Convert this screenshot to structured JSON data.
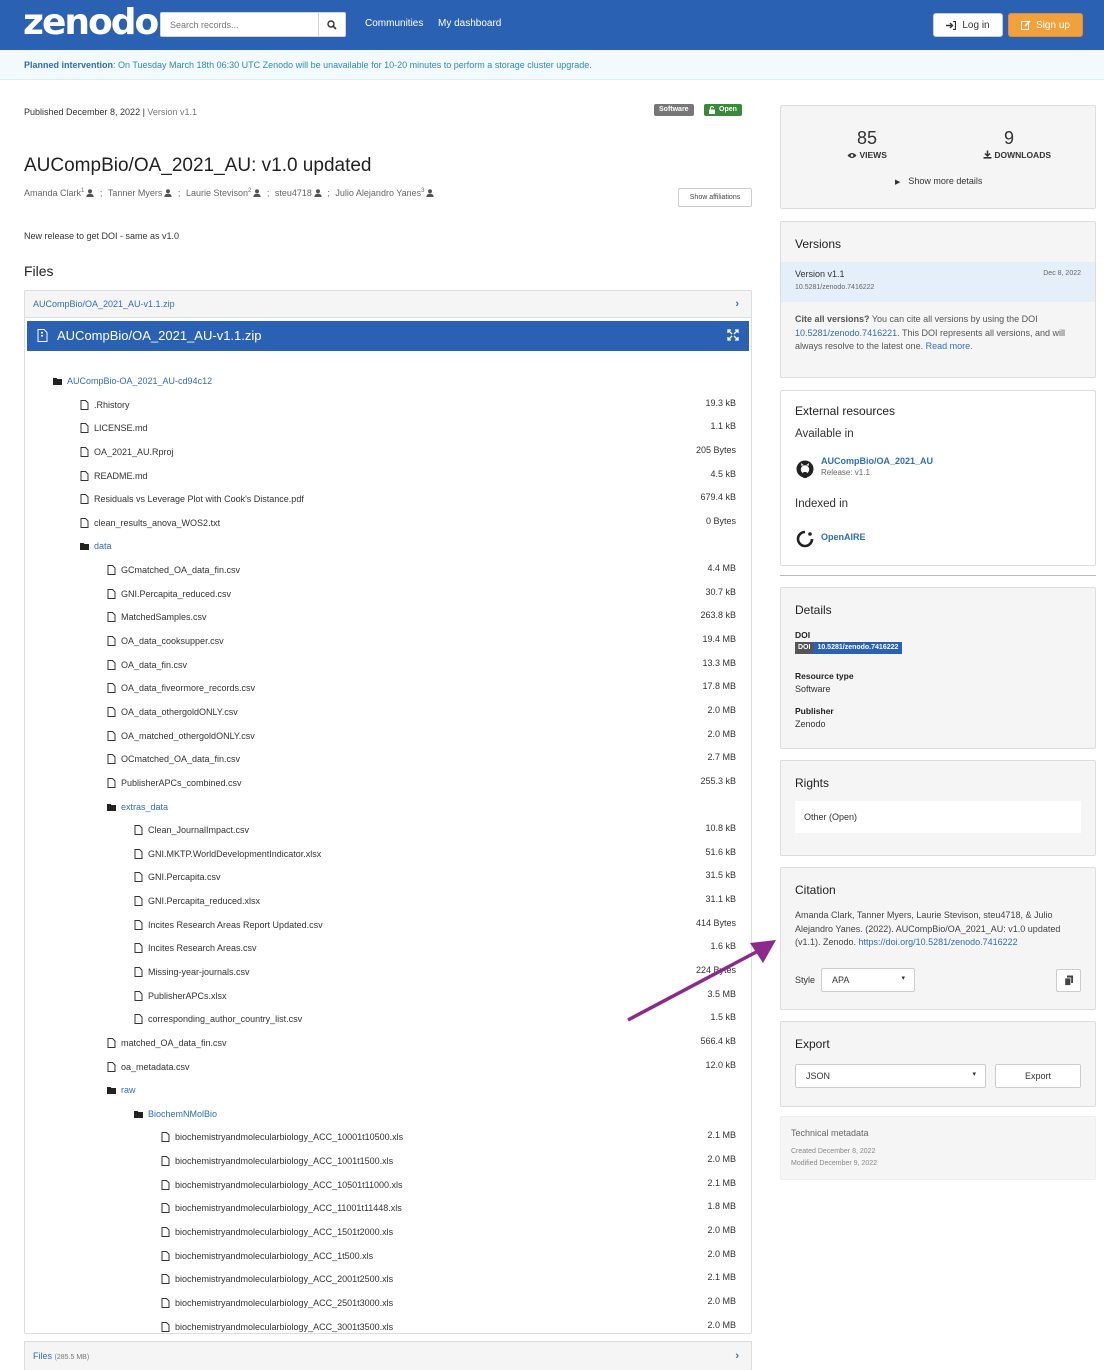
{
  "header": {
    "logo": "zenodo",
    "search_placeholder": "Search records...",
    "nav": [
      "Communities",
      "My dashboard"
    ],
    "login_label": "Log in",
    "signup_label": "Sign up"
  },
  "banner": {
    "title": "Planned intervention",
    "message": ": On Tuesday March 18th 06:30 UTC Zenodo will be unavailable for 10-20 minutes to perform a storage cluster upgrade."
  },
  "record": {
    "published": "Published December 8, 2022",
    "version": "Version v1.1",
    "badges": [
      {
        "label": "Software",
        "color": "#777777"
      },
      {
        "label": "Open",
        "color": "#3a8a3a"
      }
    ],
    "title": "AUCompBio/OA_2021_AU: v1.0 updated",
    "authors": [
      {
        "name": "Amanda Clark",
        "sup": "1"
      },
      {
        "name": "Tanner Myers",
        "sup": ""
      },
      {
        "name": "Laurie Stevison",
        "sup": "2"
      },
      {
        "name": "steu4718",
        "sup": ""
      },
      {
        "name": "Julio Alejandro Yanes",
        "sup": "3"
      }
    ],
    "show_affiliations": "Show affiliations",
    "description": "New release to get DOI - same as v1.0"
  },
  "files": {
    "heading": "Files",
    "archive_link": "AUCompBio/OA_2021_AU-v1.1.zip",
    "preview_title": "AUCompBio/OA_2021_AU-v1.1.zip",
    "footer_label": "Files",
    "footer_size": "(285.5 MB)",
    "tree": [
      {
        "name": "AUCompBio-OA_2021_AU-cd94c12",
        "size": "",
        "level": 0,
        "folder": true
      },
      {
        "name": ".Rhistory",
        "size": "19.3 kB",
        "level": 1,
        "folder": false
      },
      {
        "name": "LICENSE.md",
        "size": "1.1 kB",
        "level": 1,
        "folder": false
      },
      {
        "name": "OA_2021_AU.Rproj",
        "size": "205 Bytes",
        "level": 1,
        "folder": false
      },
      {
        "name": "README.md",
        "size": "4.5 kB",
        "level": 1,
        "folder": false
      },
      {
        "name": "Residuals vs Leverage Plot with Cook's Distance.pdf",
        "size": "679.4 kB",
        "level": 1,
        "folder": false
      },
      {
        "name": "clean_results_anova_WOS2.txt",
        "size": "0 Bytes",
        "level": 1,
        "folder": false
      },
      {
        "name": "data",
        "size": "",
        "level": 1,
        "folder": true
      },
      {
        "name": "GCmatched_OA_data_fin.csv",
        "size": "4.4 MB",
        "level": 2,
        "folder": false
      },
      {
        "name": "GNI.Percapita_reduced.csv",
        "size": "30.7 kB",
        "level": 2,
        "folder": false
      },
      {
        "name": "MatchedSamples.csv",
        "size": "263.8 kB",
        "level": 2,
        "folder": false
      },
      {
        "name": "OA_data_cooksupper.csv",
        "size": "19.4 MB",
        "level": 2,
        "folder": false
      },
      {
        "name": "OA_data_fin.csv",
        "size": "13.3 MB",
        "level": 2,
        "folder": false
      },
      {
        "name": "OA_data_fiveormore_records.csv",
        "size": "17.8 MB",
        "level": 2,
        "folder": false
      },
      {
        "name": "OA_data_othergoldONLY.csv",
        "size": "2.0 MB",
        "level": 2,
        "folder": false
      },
      {
        "name": "OA_matched_othergoldONLY.csv",
        "size": "2.0 MB",
        "level": 2,
        "folder": false
      },
      {
        "name": "OCmatched_OA_data_fin.csv",
        "size": "2.7 MB",
        "level": 2,
        "folder": false
      },
      {
        "name": "PublisherAPCs_combined.csv",
        "size": "255.3 kB",
        "level": 2,
        "folder": false
      },
      {
        "name": "extras_data",
        "size": "",
        "level": 2,
        "folder": true
      },
      {
        "name": "Clean_JournalImpact.csv",
        "size": "10.8 kB",
        "level": 3,
        "folder": false
      },
      {
        "name": "GNI.MKTP.WorldDevelopmentIndicator.xlsx",
        "size": "51.6 kB",
        "level": 3,
        "folder": false
      },
      {
        "name": "GNI.Percapita.csv",
        "size": "31.5 kB",
        "level": 3,
        "folder": false
      },
      {
        "name": "GNI.Percapita_reduced.xlsx",
        "size": "31.1 kB",
        "level": 3,
        "folder": false
      },
      {
        "name": "Incites Research Areas Report Updated.csv",
        "size": "414 Bytes",
        "level": 3,
        "folder": false
      },
      {
        "name": "Incites Research Areas.csv",
        "size": "1.6 kB",
        "level": 3,
        "folder": false
      },
      {
        "name": "Missing-year-journals.csv",
        "size": "224 Bytes",
        "level": 3,
        "folder": false
      },
      {
        "name": "PublisherAPCs.xlsx",
        "size": "3.5 MB",
        "level": 3,
        "folder": false
      },
      {
        "name": "corresponding_author_country_list.csv",
        "size": "1.5 kB",
        "level": 3,
        "folder": false
      },
      {
        "name": "matched_OA_data_fin.csv",
        "size": "566.4 kB",
        "level": 2,
        "folder": false
      },
      {
        "name": "oa_metadata.csv",
        "size": "12.0 kB",
        "level": 2,
        "folder": false
      },
      {
        "name": "raw",
        "size": "",
        "level": 2,
        "folder": true
      },
      {
        "name": "BiochemNMolBio",
        "size": "",
        "level": 3,
        "folder": true
      },
      {
        "name": "biochemistryandmolecularbiology_ACC_10001t10500.xls",
        "size": "2.1 MB",
        "level": 4,
        "folder": false
      },
      {
        "name": "biochemistryandmolecularbiology_ACC_1001t1500.xls",
        "size": "2.0 MB",
        "level": 4,
        "folder": false
      },
      {
        "name": "biochemistryandmolecularbiology_ACC_10501t11000.xls",
        "size": "2.1 MB",
        "level": 4,
        "folder": false
      },
      {
        "name": "biochemistryandmolecularbiology_ACC_11001t11448.xls",
        "size": "1.8 MB",
        "level": 4,
        "folder": false
      },
      {
        "name": "biochemistryandmolecularbiology_ACC_1501t2000.xls",
        "size": "2.0 MB",
        "level": 4,
        "folder": false
      },
      {
        "name": "biochemistryandmolecularbiology_ACC_1t500.xls",
        "size": "2.0 MB",
        "level": 4,
        "folder": false
      },
      {
        "name": "biochemistryandmolecularbiology_ACC_2001t2500.xls",
        "size": "2.1 MB",
        "level": 4,
        "folder": false
      },
      {
        "name": "biochemistryandmolecularbiology_ACC_2501t3000.xls",
        "size": "2.0 MB",
        "level": 4,
        "folder": false
      },
      {
        "name": "biochemistryandmolecularbiology_ACC_3001t3500.xls",
        "size": "2.0 MB",
        "level": 4,
        "folder": false
      }
    ]
  },
  "stats": {
    "views": "85",
    "views_label": "VIEWS",
    "downloads": "9",
    "downloads_label": "DOWNLOADS",
    "more_details": "Show more details"
  },
  "versions": {
    "heading": "Versions",
    "item_label": "Version v1.1",
    "item_date": "Dec 8, 2022",
    "item_doi": "10.5281/zenodo.7416222",
    "cite_all_bold": "Cite all versions?",
    "cite_all_text": " You can cite all versions by using the DOI",
    "concept_doi": "10.5281/zenodo.7416221",
    "cite_all_text2": ". This DOI represents all versions, and will always resolve to the latest one.",
    "read_more": "Read more."
  },
  "external": {
    "heading": "External resources",
    "available_in": "Available in",
    "repo_name": "AUCompBio/OA_2021_AU",
    "repo_release": "Release: v1.1",
    "indexed_in": "Indexed in",
    "index_name": "OpenAIRE"
  },
  "details": {
    "heading": "Details",
    "doi_label": "DOI",
    "doi_badge_left": "DOI",
    "doi_value": "10.5281/zenodo.7416222",
    "resource_type_label": "Resource type",
    "resource_type": "Software",
    "publisher_label": "Publisher",
    "publisher": "Zenodo"
  },
  "rights": {
    "heading": "Rights",
    "license": "Other (Open)"
  },
  "citation": {
    "heading": "Citation",
    "text": "Amanda Clark, Tanner Myers, Laurie Stevison, steu4718, & Julio Alejandro Yanes. (2022). AUCompBio/OA_2021_AU: v1.0 updated (v1.1). Zenodo. ",
    "link": "https://doi.org/10.5281/zenodo.7416222",
    "style_label": "Style",
    "style_value": "APA"
  },
  "export": {
    "heading": "Export",
    "format": "JSON",
    "button": "Export"
  },
  "technical": {
    "heading": "Technical metadata",
    "created": "Created December 8, 2022",
    "modified": "Modified December 9, 2022"
  },
  "colors": {
    "header_bg": "#2a61b2",
    "link": "#2f6eb5",
    "signup": "#f0a13b",
    "annotation_arrow": "#8b2a8b"
  }
}
